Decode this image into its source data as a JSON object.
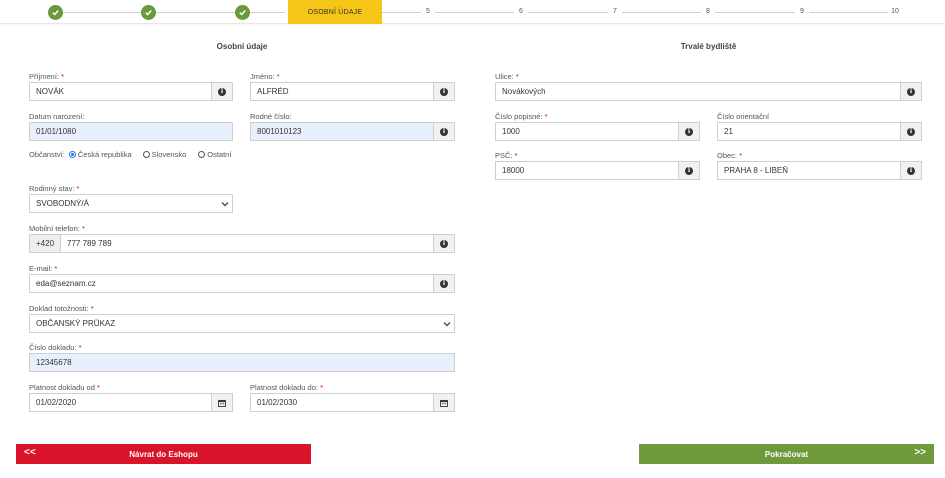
{
  "stepper": {
    "active_label": "OSOBNÍ ÚDAJE",
    "steps": [
      "5",
      "6",
      "7",
      "8",
      "9",
      "10"
    ]
  },
  "sections": {
    "personal": "Osobní údaje",
    "address": "Trvalé bydliště"
  },
  "personal": {
    "surname": {
      "label": "Příjmení: ",
      "value": "NOVÁK"
    },
    "firstname": {
      "label": "Jméno: ",
      "value": "ALFRÉD"
    },
    "birthdate": {
      "label": "Datum narození:",
      "value": "01/01/1080"
    },
    "birthnumber": {
      "label": "Rodné číslo:",
      "value": "8001010123"
    },
    "citizenship": {
      "label": "Občanství:",
      "options": [
        "Česká republika",
        "Slovensko",
        "Ostatní"
      ],
      "selected": "Česká republika"
    },
    "marital": {
      "label": "Rodinný stav: ",
      "value": "SVOBODNÝ/Á"
    },
    "phone": {
      "label": "Mobilní telefon: ",
      "prefix": "+420",
      "value": "777 789 789"
    },
    "email": {
      "label": "E-mail: ",
      "value": "eda@seznam.cz"
    },
    "idtype": {
      "label": "Doklad totožnosti: ",
      "value": "OBČANSKÝ PRŮKAZ"
    },
    "idnumber": {
      "label": "Číslo dokladu: ",
      "value": "12345678"
    },
    "valid_from": {
      "label": "Platnost dokladu od ",
      "value": "01/02/2020"
    },
    "valid_to": {
      "label": "Platnost dokladu do: ",
      "value": "01/02/2030"
    }
  },
  "address": {
    "street": {
      "label": "Ulice: ",
      "value": "Novákových"
    },
    "house_no": {
      "label": "Číslo popisné: ",
      "value": "1000"
    },
    "orient_no": {
      "label": "Číslo orientační",
      "value": "21"
    },
    "zip": {
      "label": "PSČ: ",
      "value": "18000"
    },
    "city": {
      "label": "Obec: ",
      "value": "PRAHA 8 - LIBEŇ"
    }
  },
  "required_mark": "*",
  "buttons": {
    "back": "Návrat do Eshopu",
    "next": "Pokračovat",
    "back_chevron": "<<",
    "next_chevron": ">>"
  },
  "colors": {
    "done": "#6a9a3a",
    "active": "#f5c518",
    "back": "#d9132a",
    "next": "#6e9a3c",
    "autofill": "#e8f0fe"
  },
  "icons": {
    "info": "info-icon",
    "calendar": "calendar-icon",
    "check": "check-icon",
    "select": "chevron-down-icon"
  }
}
